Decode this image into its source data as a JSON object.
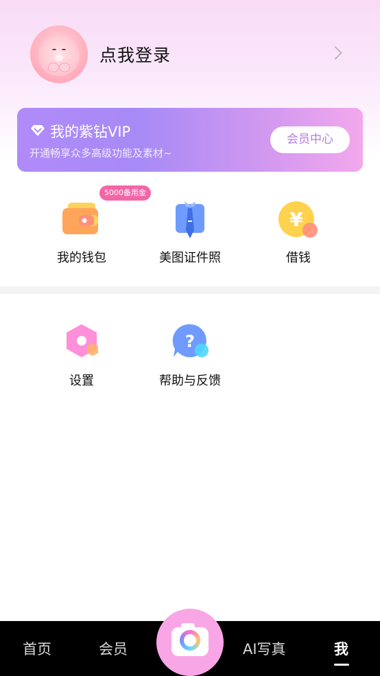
{
  "profile": {
    "login_text": "点我登录"
  },
  "vip": {
    "title": "我的紫钻VIP",
    "subtitle": "开通畅享众多高级功能及素材~",
    "center_button": "会员中心"
  },
  "services": [
    {
      "label": "我的钱包",
      "icon": "wallet-icon",
      "badge": "5000备用金"
    },
    {
      "label": "美图证件照",
      "icon": "id-photo-icon"
    },
    {
      "label": "借钱",
      "icon": "loan-yen-icon"
    }
  ],
  "tools": [
    {
      "label": "设置",
      "icon": "settings-hexagon-icon"
    },
    {
      "label": "帮助与反馈",
      "icon": "help-question-icon"
    }
  ],
  "nav": {
    "items": [
      "首页",
      "会员",
      "AI写真",
      "我"
    ],
    "active": "我",
    "center": "camera-icon"
  },
  "colors": {
    "vip_start": "#b08bf8",
    "vip_end": "#f3a8ec",
    "badge": "#f266a8",
    "nav_bg": "#000000",
    "camera_bg": "#f9a6e6"
  }
}
